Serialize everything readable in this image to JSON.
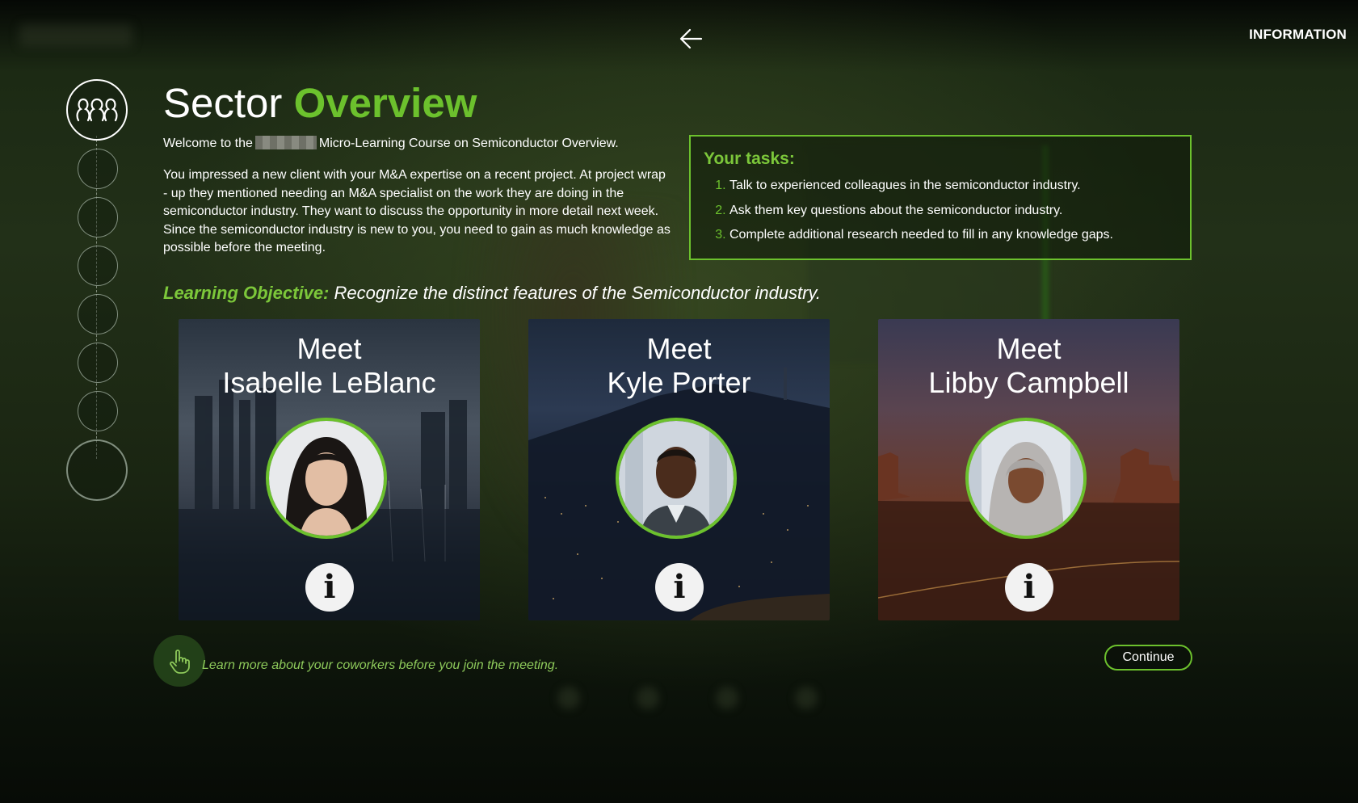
{
  "header": {
    "info_label": "INFORMATION"
  },
  "page": {
    "title_plain": "Sector ",
    "title_highlight": "Overview",
    "welcome_before": "Welcome to the",
    "welcome_after": "Micro-Learning Course on Semiconductor Overview.",
    "intro": "You impressed a new client with your M&A expertise on a recent project. At project wrap - up they mentioned needing an M&A specialist on the work they are doing in the semiconductor industry. They want to discuss the opportunity in more detail next week. Since the semiconductor industry is new to you, you need to gain as much knowledge as possible before the meeting.",
    "objective_label": "Learning Objective:",
    "objective_text": " Recognize the distinct features of the Semiconductor industry."
  },
  "tasks": {
    "heading": "Your tasks:",
    "items": [
      "Talk to experienced colleagues in the semiconductor industry.",
      "Ask them key questions about the semiconductor industry.",
      "Complete additional research needed to fill in any knowledge gaps."
    ]
  },
  "cards": [
    {
      "meet": "Meet",
      "name": "Isabelle LeBlanc"
    },
    {
      "meet": "Meet",
      "name": "Kyle Porter"
    },
    {
      "meet": "Meet",
      "name": "Libby Campbell"
    }
  ],
  "footer": {
    "hint": "Learn more about your coworkers before you join the meeting.",
    "continue_label": "Continue"
  },
  "colors": {
    "accent": "#6cc12d",
    "background": "#1c2a14"
  },
  "icons": {
    "back": "arrow-left-icon",
    "step": "people-icon",
    "info": "info-icon",
    "hint": "pointing-hand-icon"
  }
}
